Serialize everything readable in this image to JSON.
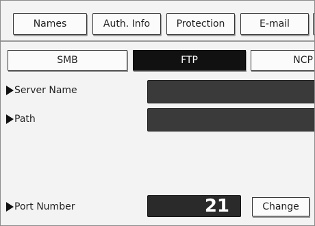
{
  "tabs": [
    {
      "label": "Names"
    },
    {
      "label": "Auth. Info"
    },
    {
      "label": "Protection"
    },
    {
      "label": "E-mail"
    }
  ],
  "protocols": [
    {
      "label": "SMB",
      "selected": false
    },
    {
      "label": "FTP",
      "selected": true
    },
    {
      "label": "NCP",
      "selected": false
    }
  ],
  "fields": {
    "server_name": {
      "label": "Server Name",
      "value": ""
    },
    "path": {
      "label": "Path",
      "value": ""
    },
    "port_number": {
      "label": "Port Number",
      "value": "21"
    }
  },
  "buttons": {
    "change_label": "Change"
  },
  "icons": {
    "field_marker": "triangle-right-icon"
  }
}
